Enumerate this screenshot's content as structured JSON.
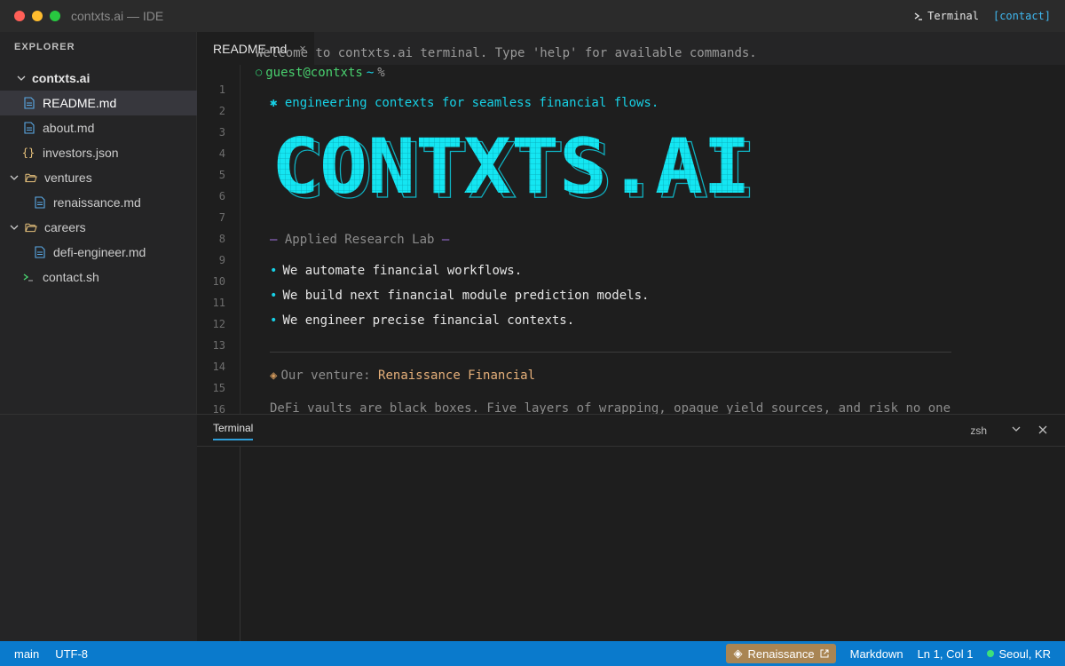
{
  "window": {
    "title": "contxts.ai — IDE",
    "terminal_label": "Terminal",
    "contact_label": "[contact]"
  },
  "sidebar": {
    "header": "EXPLORER",
    "root": "contxts.ai",
    "items": [
      {
        "label": "README.md",
        "type": "md"
      },
      {
        "label": "about.md",
        "type": "md"
      },
      {
        "label": "investors.json",
        "type": "json"
      },
      {
        "label": "ventures",
        "type": "folder"
      },
      {
        "label": "renaissance.md",
        "type": "md"
      },
      {
        "label": "careers",
        "type": "folder"
      },
      {
        "label": "defi-engineer.md",
        "type": "md"
      },
      {
        "label": "contact.sh",
        "type": "sh"
      }
    ]
  },
  "editor": {
    "tab_label": "README.md",
    "tab_close": "×",
    "line_numbers": [
      "1",
      "2",
      "3",
      "4",
      "5",
      "6",
      "7",
      "8",
      "9",
      "10",
      "11",
      "12",
      "13",
      "14",
      "15",
      "16"
    ],
    "tagline": "✱ engineering contexts for seamless financial flows.",
    "logo_text": "CONTXTS.AI",
    "lab_dash": "—",
    "lab": "Applied Research Lab",
    "bullets": [
      "We automate financial workflows.",
      "We build next financial module prediction models.",
      "We engineer precise financial contexts."
    ],
    "venture_prefix": "Our venture:",
    "venture_name": "Renaissance Financial",
    "description": "DeFi vaults are black boxes. Five layers of wrapping, opaque yield sources, and risk no one"
  },
  "terminal": {
    "tab": "Terminal",
    "shell": "zsh",
    "welcome": "Welcome to contxts.ai terminal. Type 'help' for available commands.",
    "prompt_user": "guest@contxts",
    "prompt_dir": "~",
    "prompt_symbol": "%"
  },
  "statusbar": {
    "branch": "main",
    "encoding": "UTF-8",
    "badge": "Renaissance",
    "language": "Markdown",
    "position": "Ln 1, Col 1",
    "location": "Seoul, KR"
  },
  "colors": {
    "accent_cyan": "#17d1e6",
    "status_blue": "#0a7acc",
    "badge_gold": "#a98553"
  }
}
